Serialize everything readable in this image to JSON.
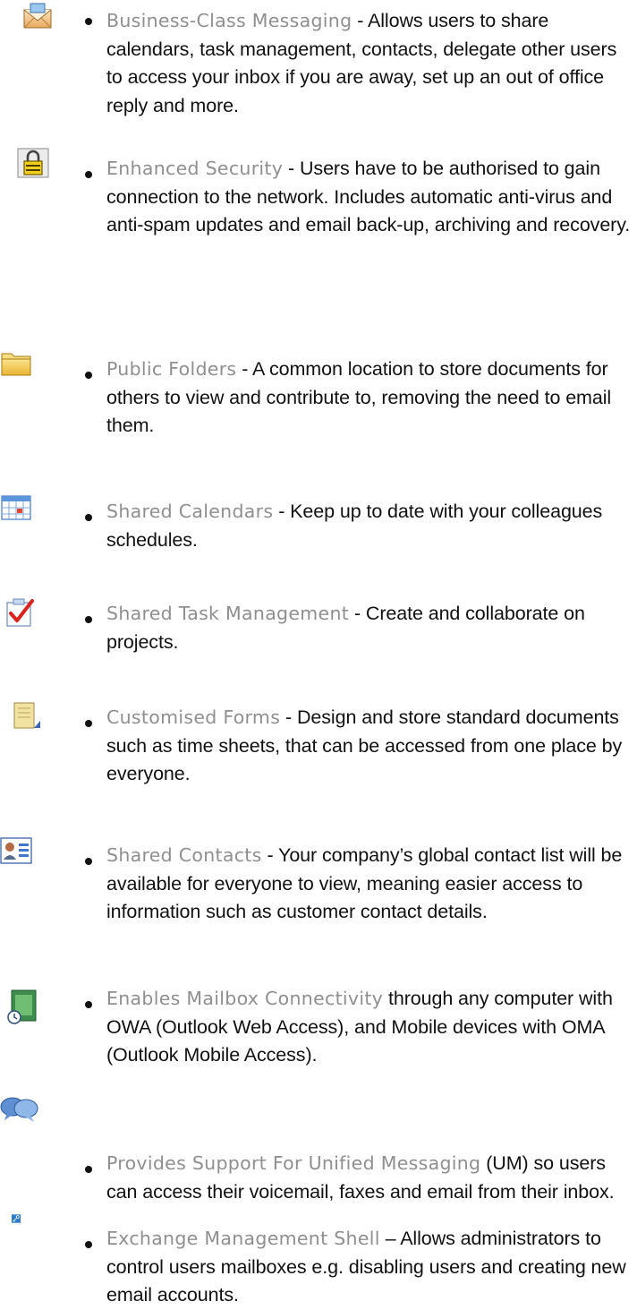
{
  "items": [
    {
      "title": "Business-Class Messaging",
      "sep": " - ",
      "desc": "Allows users to share calendars, task management, contacts, delegate other users to access your inbox if you are away, set up an out of office reply and more.",
      "icon": "envelope-icon"
    },
    {
      "title": "Enhanced Security",
      "sep": " - ",
      "desc": "Users have to be authorised to gain connection to the network. Includes automatic anti-virus and anti-spam updates and email back-up, archiving  and recovery.",
      "icon": "padlock-icon"
    },
    {
      "title": "Public Folders",
      "sep": " - ",
      "desc": "A common location to store documents for others to view and contribute to, removing the need to email them.",
      "icon": "folder-icon"
    },
    {
      "title": "Shared Calendars",
      "sep": " - ",
      "desc": "Keep up to date with your colleagues schedules.",
      "icon": "calendar-icon"
    },
    {
      "title": "Shared Task Management",
      "sep": " - ",
      "desc": "Create and collaborate on projects.",
      "icon": "task-check-icon"
    },
    {
      "title": "Customised Forms",
      "sep": " - ",
      "desc": "Design and store standard documents such as time sheets, that can be accessed from one place by everyone.",
      "icon": "form-notepad-icon"
    },
    {
      "title": "Shared Contacts",
      "sep": " - ",
      "desc": "Your company’s global contact list will be available for everyone to view, meaning easier access to information such as customer contact details.",
      "icon": "contact-card-icon"
    },
    {
      "title": "Enables Mailbox Connectivity",
      "sep": " ",
      "desc": "through any computer with OWA (Outlook Web Access), and Mobile devices with OMA (Outlook Mobile Access).",
      "icon": "mailbox-clock-icon"
    },
    {
      "title": "Provides Support For Unified Messaging",
      "sep": " ",
      "desc": "(UM) so users can access their voicemail, faxes and email from their inbox.",
      "icon": "speech-bubbles-icon"
    },
    {
      "title": "Exchange Management Shell",
      "sep": " – ",
      "desc": "Allows administrators to control users mailboxes e.g. disabling users and creating new email accounts.",
      "icon": "key-icon"
    }
  ]
}
